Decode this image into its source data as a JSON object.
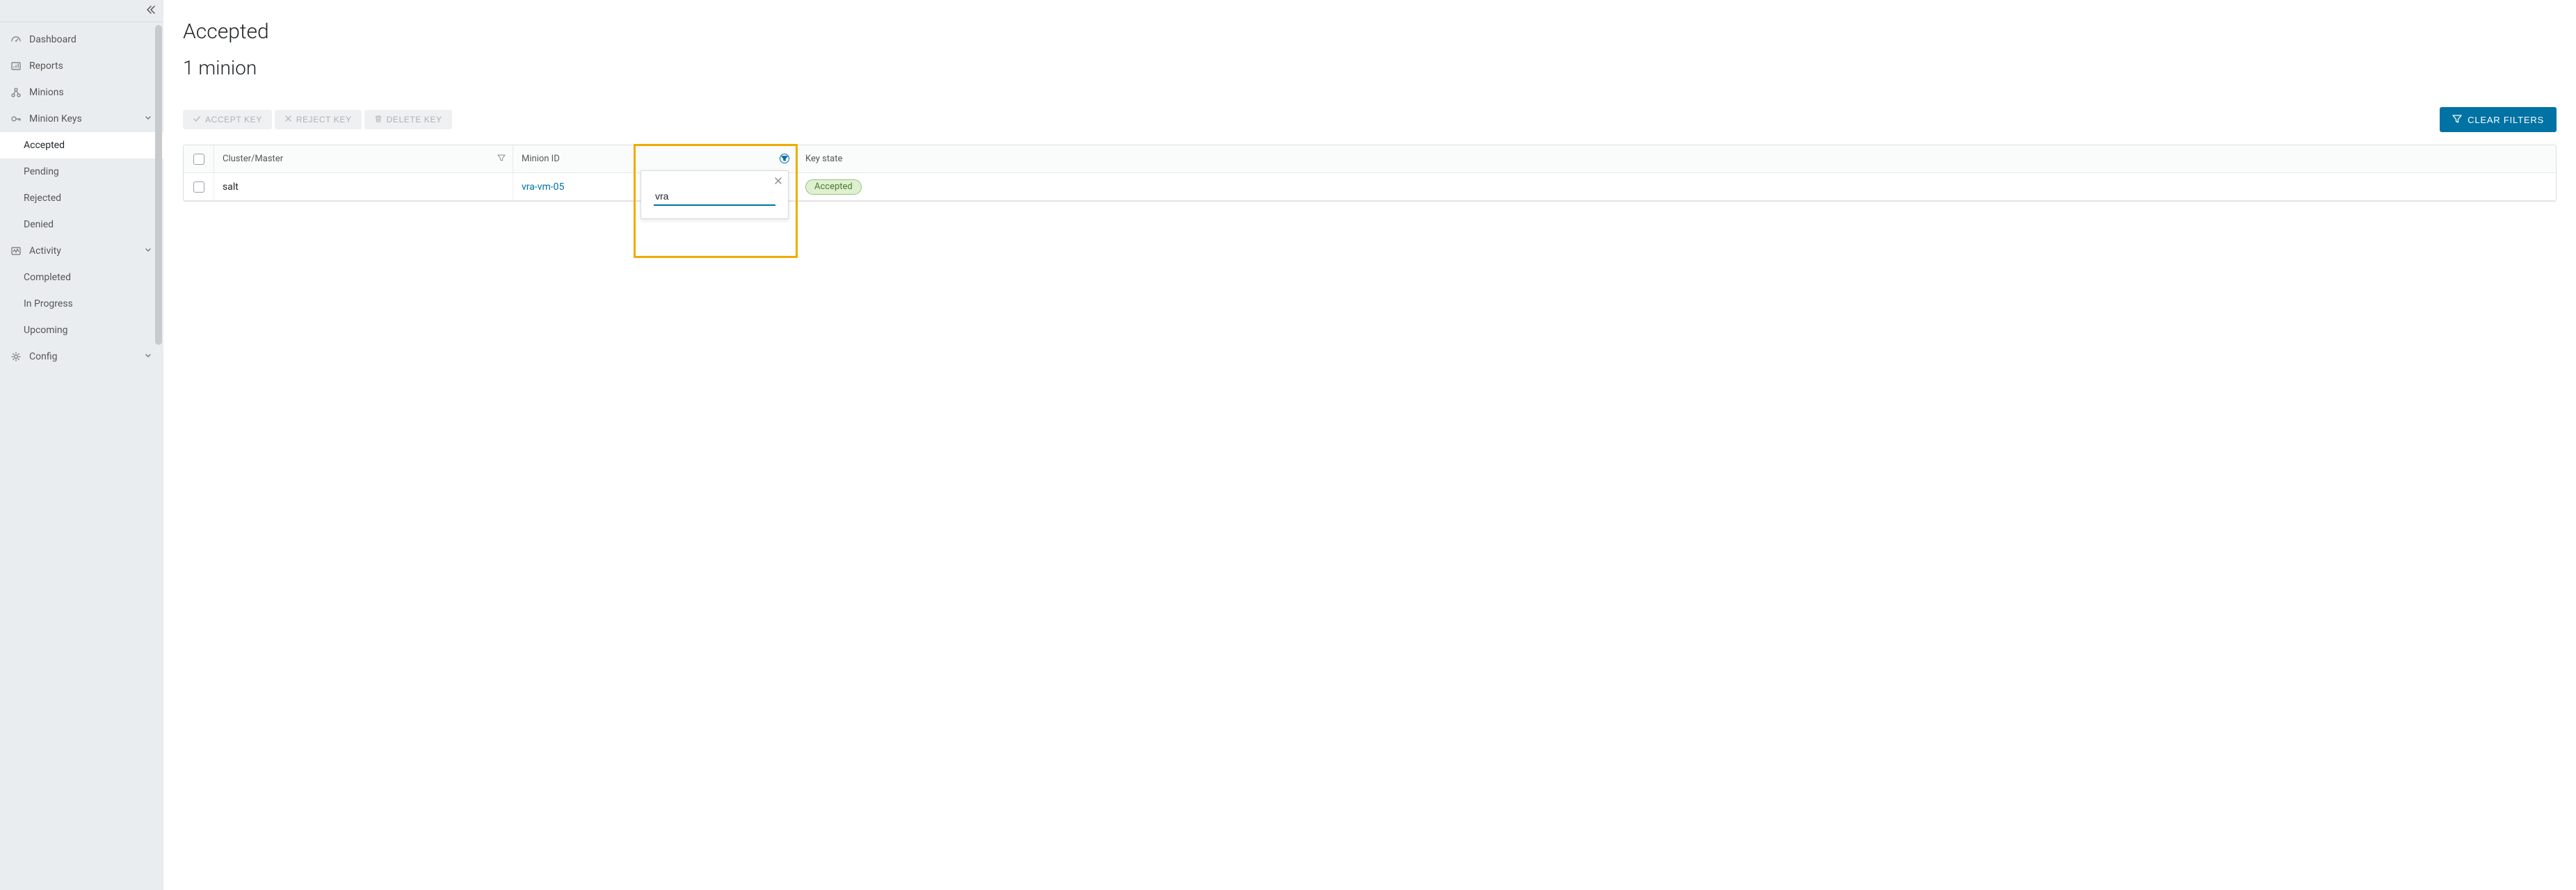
{
  "sidebar": {
    "items": [
      {
        "label": "Dashboard"
      },
      {
        "label": "Reports"
      },
      {
        "label": "Minions"
      },
      {
        "label": "Minion Keys"
      },
      {
        "label": "Activity"
      },
      {
        "label": "Config"
      }
    ],
    "minion_keys_sub": [
      {
        "label": "Accepted"
      },
      {
        "label": "Pending"
      },
      {
        "label": "Rejected"
      },
      {
        "label": "Denied"
      }
    ],
    "activity_sub": [
      {
        "label": "Completed"
      },
      {
        "label": "In Progress"
      },
      {
        "label": "Upcoming"
      }
    ]
  },
  "page": {
    "title": "Accepted",
    "subtitle": "1 minion"
  },
  "toolbar": {
    "accept": "ACCEPT KEY",
    "reject": "REJECT KEY",
    "delete": "DELETE KEY",
    "clear_filters": "CLEAR FILTERS"
  },
  "table": {
    "headers": {
      "cluster": "Cluster/Master",
      "minion_id": "Minion ID",
      "key_state": "Key state"
    },
    "rows": [
      {
        "cluster": "salt",
        "minion_id": "vra-vm-05",
        "key_state": "Accepted"
      }
    ]
  },
  "filter": {
    "value": "vra"
  }
}
